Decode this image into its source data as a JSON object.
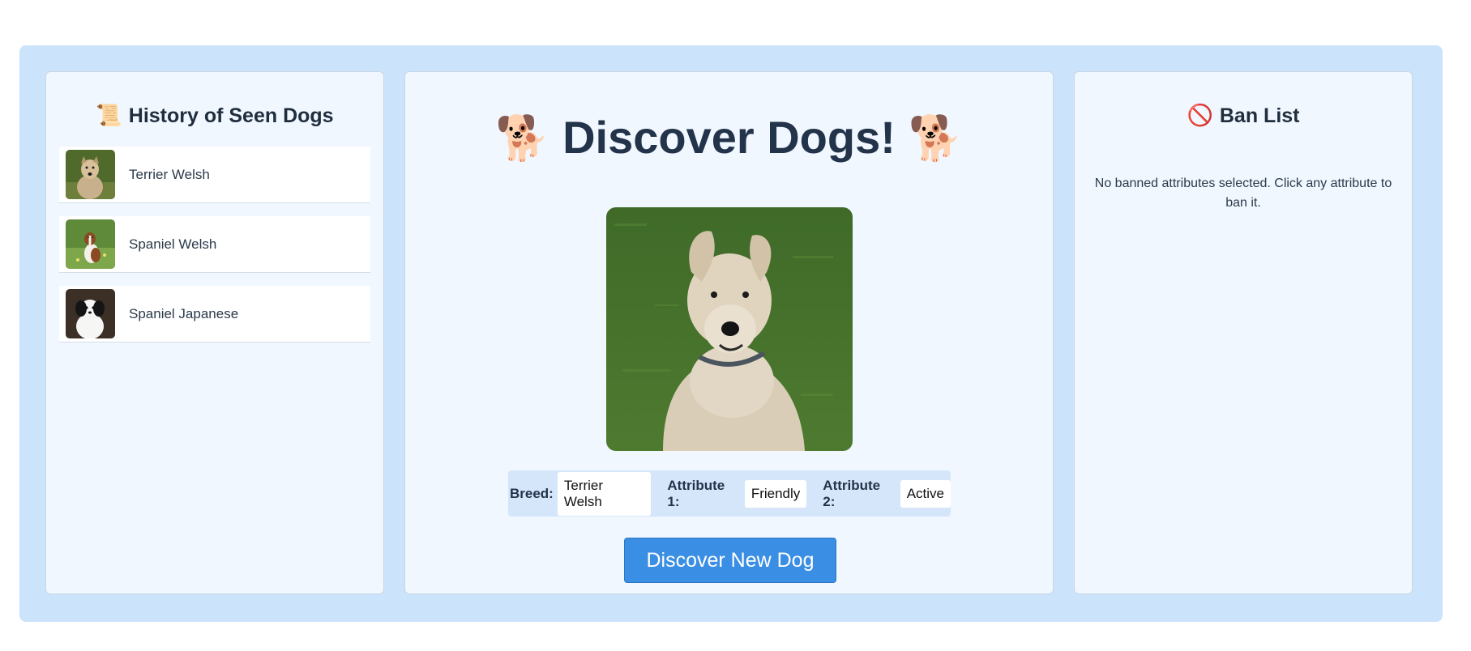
{
  "history": {
    "icon": "scroll-icon",
    "icon_glyph": "📜",
    "title": "History of Seen Dogs",
    "items": [
      {
        "label": "Terrier Welsh"
      },
      {
        "label": "Spaniel Welsh"
      },
      {
        "label": "Spaniel Japanese"
      }
    ]
  },
  "main": {
    "title": "Discover Dogs!",
    "title_icon": "dog-icon",
    "title_icon_glyph": "🐕",
    "breed_label": "Breed:",
    "breed_value": "Terrier Welsh",
    "attr1_label": "Attribute 1:",
    "attr1_value": "Friendly",
    "attr2_label": "Attribute 2:",
    "attr2_value": "Active",
    "discover_button": "Discover New Dog"
  },
  "ban": {
    "icon": "prohibited-icon",
    "icon_glyph": "🚫",
    "title": "Ban List",
    "empty_message": "No banned attributes selected. Click any attribute to ban it."
  },
  "colors": {
    "app_background": "#cbe3fb",
    "panel_background": "#f0f7ff",
    "button": "#3a8ee3",
    "attribute_bar": "#d5e6fb"
  }
}
